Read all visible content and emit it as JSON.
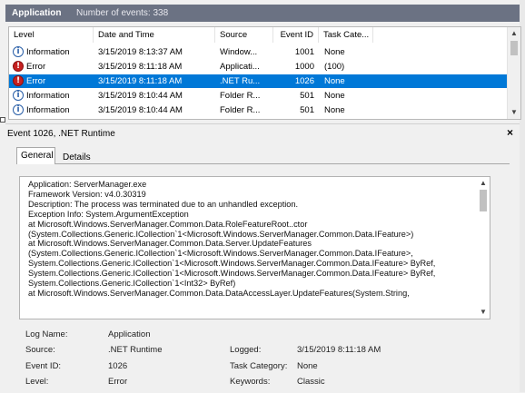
{
  "header": {
    "title": "Application",
    "count": "Number of events: 338"
  },
  "list": {
    "columns": [
      "Level",
      "Date and Time",
      "Source",
      "Event ID",
      "Task Cate..."
    ],
    "rows": [
      {
        "level": "Information",
        "date": "3/15/2019 8:13:37 AM",
        "source": "Window...",
        "id": "1001",
        "task": "None"
      },
      {
        "level": "Error",
        "date": "3/15/2019 8:11:18 AM",
        "source": "Applicati...",
        "id": "1000",
        "task": "(100)"
      },
      {
        "level": "Error",
        "date": "3/15/2019 8:11:18 AM",
        "source": ".NET Ru...",
        "id": "1026",
        "task": "None"
      },
      {
        "level": "Information",
        "date": "3/15/2019 8:10:44 AM",
        "source": "Folder R...",
        "id": "501",
        "task": "None"
      },
      {
        "level": "Information",
        "date": "3/15/2019 8:10:44 AM",
        "source": "Folder R...",
        "id": "501",
        "task": "None"
      }
    ]
  },
  "detail": {
    "title": "Event 1026, .NET Runtime",
    "close_glyph": "×",
    "tabs": [
      "General",
      "Details"
    ],
    "description_lines": [
      "Application: ServerManager.exe",
      "Framework Version: v4.0.30319",
      "Description: The process was terminated due to an unhandled exception.",
      "Exception Info: System.ArgumentException",
      "   at Microsoft.Windows.ServerManager.Common.Data.RoleFeatureRoot..ctor",
      "(System.Collections.Generic.ICollection`1<Microsoft.Windows.ServerManager.Common.Data.IFeature>)",
      "   at Microsoft.Windows.ServerManager.Common.Data.Server.UpdateFeatures",
      "(System.Collections.Generic.ICollection`1<Microsoft.Windows.ServerManager.Common.Data.IFeature>,",
      "System.Collections.Generic.ICollection`1<Microsoft.Windows.ServerManager.Common.Data.IFeature> ByRef,",
      "System.Collections.Generic.ICollection`1<Microsoft.Windows.ServerManager.Common.Data.IFeature> ByRef,",
      "System.Collections.Generic.ICollection`1<Int32> ByRef)",
      "   at Microsoft.Windows.ServerManager.Common.Data.DataAccessLayer.UpdateFeatures(System.String,"
    ],
    "fields": {
      "log_name_label": "Log Name:",
      "log_name": "Application",
      "source_label": "Source:",
      "source": ".NET Runtime",
      "logged_label": "Logged:",
      "logged": "3/15/2019 8:11:18 AM",
      "event_id_label": "Event ID:",
      "event_id": "1026",
      "task_category_label": "Task Category:",
      "task_category": "None",
      "level_label": "Level:",
      "level": "Error",
      "keywords_label": "Keywords:",
      "keywords": "Classic"
    }
  },
  "colors": {
    "header_bg": "#6b7283",
    "selection": "#0078d7",
    "error_icon": "#c62020",
    "info_icon": "#2a5fa8"
  }
}
